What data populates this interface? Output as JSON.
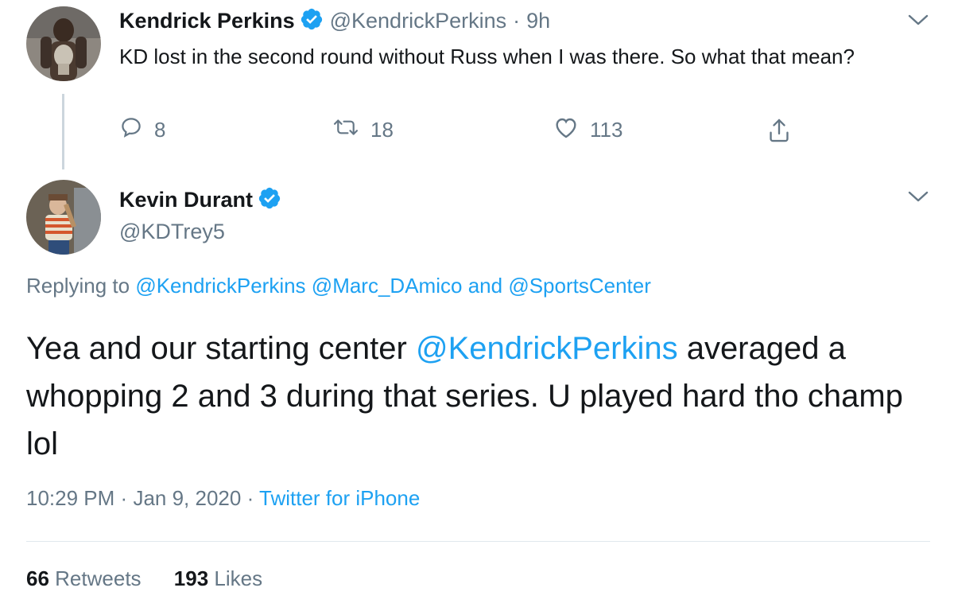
{
  "parent_tweet": {
    "author_name": "Kendrick Perkins",
    "author_handle": "@KendrickPerkins",
    "separator": "·",
    "time_ago": "9h",
    "text": "KD lost in the second round without Russ when I was there. So what that mean?",
    "actions": {
      "replies": "8",
      "retweets": "18",
      "likes": "113"
    }
  },
  "main_tweet": {
    "author_name": "Kevin Durant",
    "author_handle": "@KDTrey5",
    "replying": {
      "prefix": "Replying to",
      "mention1": "@KendrickPerkins",
      "mention2": "@Marc_DAmico",
      "joiner": "and",
      "mention3": "@SportsCenter"
    },
    "text_before": "Yea and our starting center ",
    "text_mention": "@KendrickPerkins",
    "text_after": " averaged a whopping 2 and 3 during that series. U played hard tho champ lol",
    "time": "10:29 PM",
    "dot": "·",
    "date": "Jan 9, 2020",
    "source": "Twitter for iPhone",
    "stats": {
      "retweets_count": "66",
      "retweets_label": "Retweets",
      "likes_count": "193",
      "likes_label": "Likes"
    }
  },
  "colors": {
    "link": "#1da1f2",
    "secondary_text": "#657786",
    "primary_text": "#14171a",
    "verified_badge": "#1da1f2",
    "divider": "#e1e8ed"
  },
  "icons": {
    "reply": "reply-icon",
    "retweet": "retweet-icon",
    "like": "heart-icon",
    "share": "share-icon",
    "menu": "chevron-down-icon",
    "verified": "verified-badge-icon"
  }
}
